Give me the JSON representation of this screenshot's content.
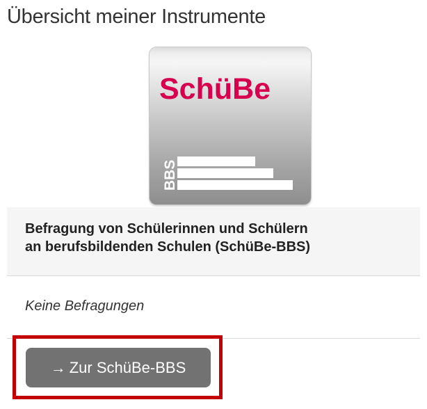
{
  "page": {
    "title": "Übersicht meiner Instrumente"
  },
  "instrument": {
    "logo": {
      "wordmark": "SchüBe",
      "side_text": "BBS",
      "wordmark_color": "#d6004f"
    },
    "title_line1": "Befragung von Schülerinnen und Schülern",
    "title_line2": "an berufsbildenden Schulen (SchüBe-BBS)",
    "status": "Keine Befragungen",
    "button": {
      "arrow": "→",
      "label": "Zur SchüBe-BBS"
    }
  },
  "colors": {
    "highlight": "#c40000",
    "button_bg": "#727272"
  }
}
